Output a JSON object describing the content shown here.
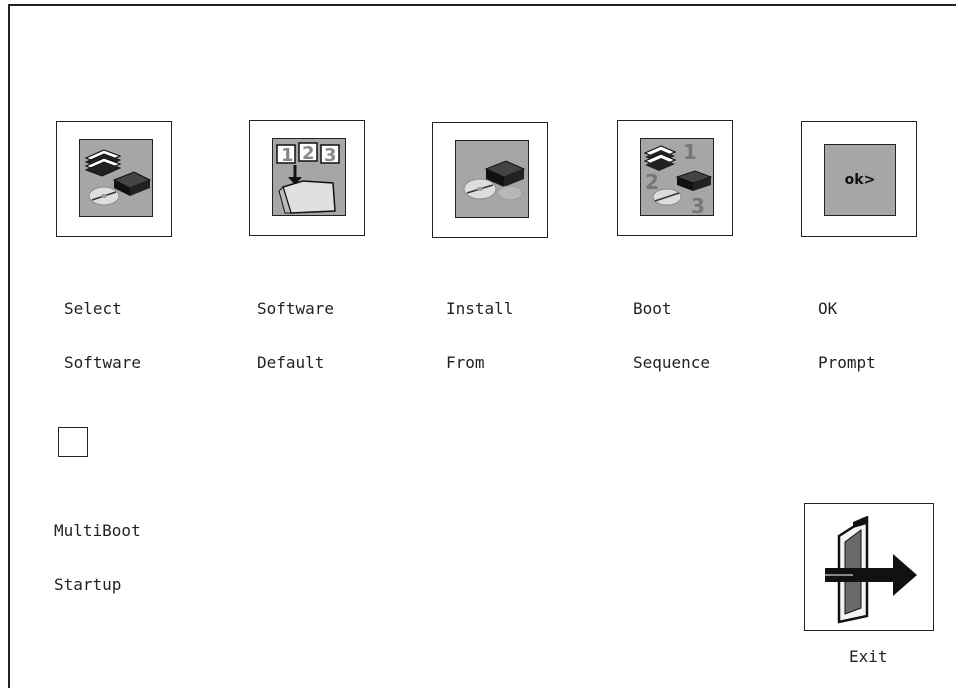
{
  "menu": {
    "items": [
      {
        "line1": "Select",
        "line2": "Software",
        "icon": "select-software-icon"
      },
      {
        "line1": "Software",
        "line2": "Default",
        "icon": "software-default-icon"
      },
      {
        "line1": "Install",
        "line2": "From",
        "icon": "install-from-icon"
      },
      {
        "line1": "Boot",
        "line2": "Sequence",
        "icon": "boot-sequence-icon"
      },
      {
        "line1": "OK",
        "line2": "Prompt",
        "icon": "ok-prompt-icon",
        "icon_text": "ok>"
      }
    ]
  },
  "multiboot": {
    "line1": "MultiBoot",
    "line2": "Startup",
    "checked": false
  },
  "exit": {
    "label": "Exit",
    "icon": "exit-door-arrow-icon"
  },
  "colors": {
    "icon_gray": "#a6a6a6",
    "dark": "#222222"
  }
}
